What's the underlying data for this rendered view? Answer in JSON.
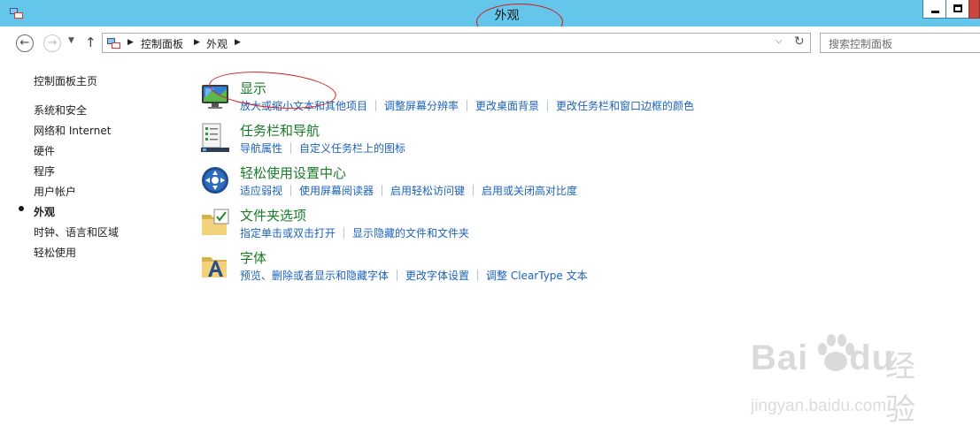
{
  "window": {
    "title": "外观",
    "icon": "control-panel-icon",
    "controls": [
      "minimize-icon",
      "maximize-icon"
    ]
  },
  "nav": {
    "back_icon": "back-arrow-icon",
    "forward_icon": "forward-arrow-icon",
    "recent_icon": "chevron-down-icon",
    "up_icon": "up-arrow-icon",
    "breadcrumb": [
      "控制面板",
      "外观"
    ],
    "search_placeholder": "搜索控制面板"
  },
  "sidebar": {
    "home": "控制面板主页",
    "items": [
      {
        "label": "系统和安全",
        "active": false
      },
      {
        "label": "网络和 Internet",
        "active": false
      },
      {
        "label": "硬件",
        "active": false
      },
      {
        "label": "程序",
        "active": false
      },
      {
        "label": "用户帐户",
        "active": false
      },
      {
        "label": "外观",
        "active": true
      },
      {
        "label": "时钟、语言和区域",
        "active": false
      },
      {
        "label": "轻松使用",
        "active": false
      }
    ]
  },
  "categories": [
    {
      "title": "显示",
      "icon": "display-icon",
      "links": [
        "放大或缩小文本和其他项目",
        "调整屏幕分辨率",
        "更改桌面背景",
        "更改任务栏和窗口边框的颜色"
      ]
    },
    {
      "title": "任务栏和导航",
      "icon": "taskbar-icon",
      "links": [
        "导航属性",
        "自定义任务栏上的图标"
      ]
    },
    {
      "title": "轻松使用设置中心",
      "icon": "ease-of-access-icon",
      "links": [
        "适应弱视",
        "使用屏幕阅读器",
        "启用轻松访问键",
        "启用或关闭高对比度"
      ]
    },
    {
      "title": "文件夹选项",
      "icon": "folder-options-icon",
      "links": [
        "指定单击或双击打开",
        "显示隐藏的文件和文件夹"
      ]
    },
    {
      "title": "字体",
      "icon": "fonts-icon",
      "links": [
        "预览、删除或者显示和隐藏字体",
        "更改字体设置",
        "调整 ClearType 文本"
      ]
    }
  ],
  "watermark": {
    "brand_left": "Bai",
    "brand_right": "du",
    "text": "经验",
    "url": "jingyan.baidu.com"
  },
  "colors": {
    "titlebar": "#63c6ea",
    "category_title": "#1a7a28",
    "link": "#1b62b8",
    "annotation": "#d51a1a"
  }
}
